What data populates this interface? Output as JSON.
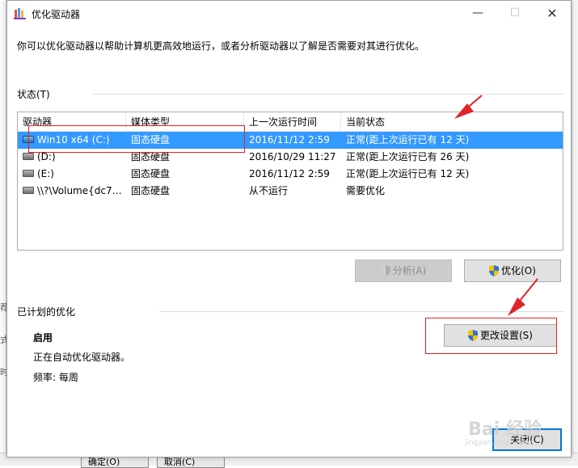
{
  "window": {
    "title": "优化驱动器",
    "controls": {
      "minimize": "—",
      "maximize": "☐",
      "close": "✕"
    }
  },
  "description": "你可以优化驱动器以帮助计算机更高效地运行，或者分析驱动器以了解是否需要对其进行优化。",
  "status_section": {
    "label": "状态(T)"
  },
  "table": {
    "columns": [
      "驱动器",
      "媒体类型",
      "上一次运行时间",
      "当前状态"
    ],
    "rows": [
      {
        "drive": "Win10 x64 (C:)",
        "media": "固态硬盘",
        "last_run": "2016/11/12 2:59",
        "status": "正常(距上次运行已有 12 天)",
        "selected": true,
        "icon": "system-drive-icon"
      },
      {
        "drive": "(D:)",
        "media": "固态硬盘",
        "last_run": "2016/10/29 11:27",
        "status": "正常(距上次运行已有 26 天)",
        "selected": false,
        "icon": "drive-icon"
      },
      {
        "drive": "(E:)",
        "media": "固态硬盘",
        "last_run": "2016/11/12 2:59",
        "status": "正常(距上次运行已有 12 天)",
        "selected": false,
        "icon": "drive-icon"
      },
      {
        "drive": "\\\\?\\Volume{dc7d...",
        "media": "固态硬盘",
        "last_run": "从不运行",
        "status": "需要优化",
        "selected": false,
        "icon": "drive-icon"
      }
    ]
  },
  "buttons": {
    "analyze": "分析(A)",
    "optimize": "优化(O)",
    "change_settings": "更改设置(S)",
    "close": "关闭(C)"
  },
  "schedule_section": {
    "label": "已计划的优化",
    "state": "启用",
    "detail": "正在自动优化驱动器。",
    "frequency": "频率: 每周"
  },
  "background": {
    "left_chars": [
      "荐",
      "式",
      "时"
    ],
    "bottom_buttons": [
      "确定(O)",
      "取消(C)"
    ]
  },
  "watermark": {
    "text": "Bai 经验",
    "sub": "jingyan.baidu.com"
  },
  "colors": {
    "selection": "#3399ff",
    "annotation": "#e0242b",
    "accent": "#0078d7"
  }
}
